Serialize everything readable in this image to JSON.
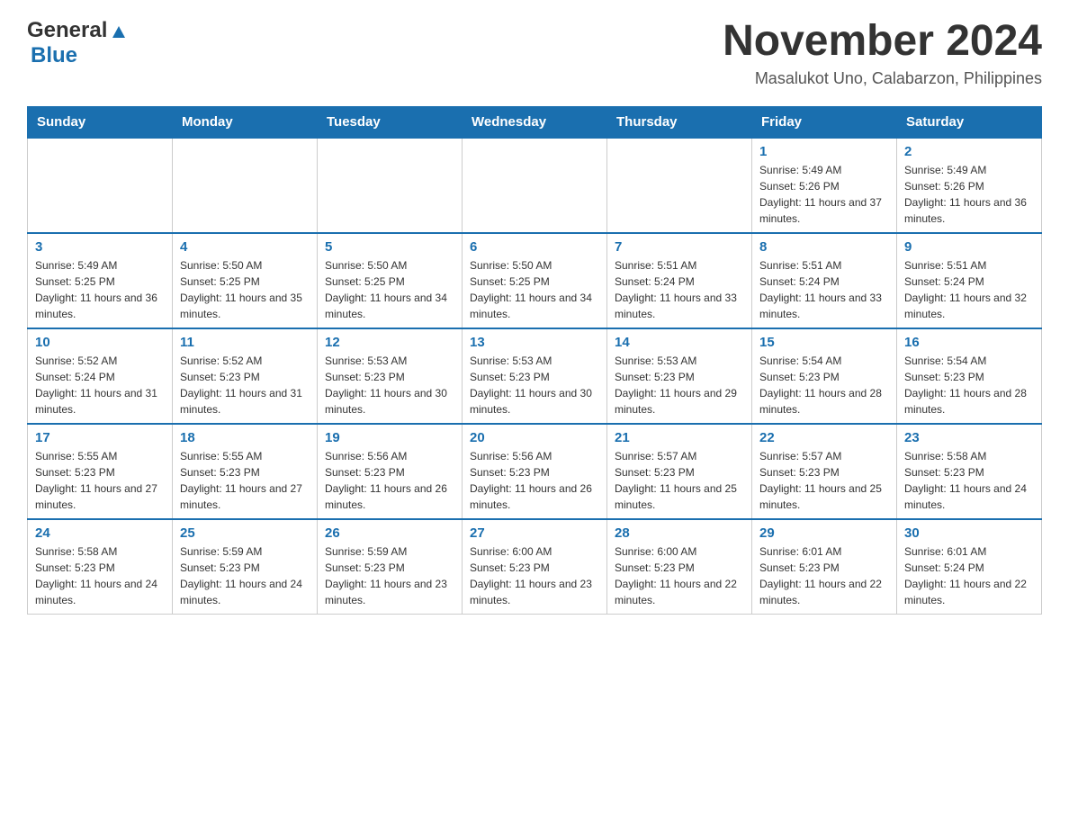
{
  "header": {
    "logo_general": "General",
    "logo_blue": "Blue",
    "title": "November 2024",
    "location": "Masalukot Uno, Calabarzon, Philippines"
  },
  "calendar": {
    "days_of_week": [
      "Sunday",
      "Monday",
      "Tuesday",
      "Wednesday",
      "Thursday",
      "Friday",
      "Saturday"
    ],
    "weeks": [
      [
        {
          "day": "",
          "info": ""
        },
        {
          "day": "",
          "info": ""
        },
        {
          "day": "",
          "info": ""
        },
        {
          "day": "",
          "info": ""
        },
        {
          "day": "",
          "info": ""
        },
        {
          "day": "1",
          "info": "Sunrise: 5:49 AM\nSunset: 5:26 PM\nDaylight: 11 hours and 37 minutes."
        },
        {
          "day": "2",
          "info": "Sunrise: 5:49 AM\nSunset: 5:26 PM\nDaylight: 11 hours and 36 minutes."
        }
      ],
      [
        {
          "day": "3",
          "info": "Sunrise: 5:49 AM\nSunset: 5:25 PM\nDaylight: 11 hours and 36 minutes."
        },
        {
          "day": "4",
          "info": "Sunrise: 5:50 AM\nSunset: 5:25 PM\nDaylight: 11 hours and 35 minutes."
        },
        {
          "day": "5",
          "info": "Sunrise: 5:50 AM\nSunset: 5:25 PM\nDaylight: 11 hours and 34 minutes."
        },
        {
          "day": "6",
          "info": "Sunrise: 5:50 AM\nSunset: 5:25 PM\nDaylight: 11 hours and 34 minutes."
        },
        {
          "day": "7",
          "info": "Sunrise: 5:51 AM\nSunset: 5:24 PM\nDaylight: 11 hours and 33 minutes."
        },
        {
          "day": "8",
          "info": "Sunrise: 5:51 AM\nSunset: 5:24 PM\nDaylight: 11 hours and 33 minutes."
        },
        {
          "day": "9",
          "info": "Sunrise: 5:51 AM\nSunset: 5:24 PM\nDaylight: 11 hours and 32 minutes."
        }
      ],
      [
        {
          "day": "10",
          "info": "Sunrise: 5:52 AM\nSunset: 5:24 PM\nDaylight: 11 hours and 31 minutes."
        },
        {
          "day": "11",
          "info": "Sunrise: 5:52 AM\nSunset: 5:23 PM\nDaylight: 11 hours and 31 minutes."
        },
        {
          "day": "12",
          "info": "Sunrise: 5:53 AM\nSunset: 5:23 PM\nDaylight: 11 hours and 30 minutes."
        },
        {
          "day": "13",
          "info": "Sunrise: 5:53 AM\nSunset: 5:23 PM\nDaylight: 11 hours and 30 minutes."
        },
        {
          "day": "14",
          "info": "Sunrise: 5:53 AM\nSunset: 5:23 PM\nDaylight: 11 hours and 29 minutes."
        },
        {
          "day": "15",
          "info": "Sunrise: 5:54 AM\nSunset: 5:23 PM\nDaylight: 11 hours and 28 minutes."
        },
        {
          "day": "16",
          "info": "Sunrise: 5:54 AM\nSunset: 5:23 PM\nDaylight: 11 hours and 28 minutes."
        }
      ],
      [
        {
          "day": "17",
          "info": "Sunrise: 5:55 AM\nSunset: 5:23 PM\nDaylight: 11 hours and 27 minutes."
        },
        {
          "day": "18",
          "info": "Sunrise: 5:55 AM\nSunset: 5:23 PM\nDaylight: 11 hours and 27 minutes."
        },
        {
          "day": "19",
          "info": "Sunrise: 5:56 AM\nSunset: 5:23 PM\nDaylight: 11 hours and 26 minutes."
        },
        {
          "day": "20",
          "info": "Sunrise: 5:56 AM\nSunset: 5:23 PM\nDaylight: 11 hours and 26 minutes."
        },
        {
          "day": "21",
          "info": "Sunrise: 5:57 AM\nSunset: 5:23 PM\nDaylight: 11 hours and 25 minutes."
        },
        {
          "day": "22",
          "info": "Sunrise: 5:57 AM\nSunset: 5:23 PM\nDaylight: 11 hours and 25 minutes."
        },
        {
          "day": "23",
          "info": "Sunrise: 5:58 AM\nSunset: 5:23 PM\nDaylight: 11 hours and 24 minutes."
        }
      ],
      [
        {
          "day": "24",
          "info": "Sunrise: 5:58 AM\nSunset: 5:23 PM\nDaylight: 11 hours and 24 minutes."
        },
        {
          "day": "25",
          "info": "Sunrise: 5:59 AM\nSunset: 5:23 PM\nDaylight: 11 hours and 24 minutes."
        },
        {
          "day": "26",
          "info": "Sunrise: 5:59 AM\nSunset: 5:23 PM\nDaylight: 11 hours and 23 minutes."
        },
        {
          "day": "27",
          "info": "Sunrise: 6:00 AM\nSunset: 5:23 PM\nDaylight: 11 hours and 23 minutes."
        },
        {
          "day": "28",
          "info": "Sunrise: 6:00 AM\nSunset: 5:23 PM\nDaylight: 11 hours and 22 minutes."
        },
        {
          "day": "29",
          "info": "Sunrise: 6:01 AM\nSunset: 5:23 PM\nDaylight: 11 hours and 22 minutes."
        },
        {
          "day": "30",
          "info": "Sunrise: 6:01 AM\nSunset: 5:24 PM\nDaylight: 11 hours and 22 minutes."
        }
      ]
    ]
  }
}
